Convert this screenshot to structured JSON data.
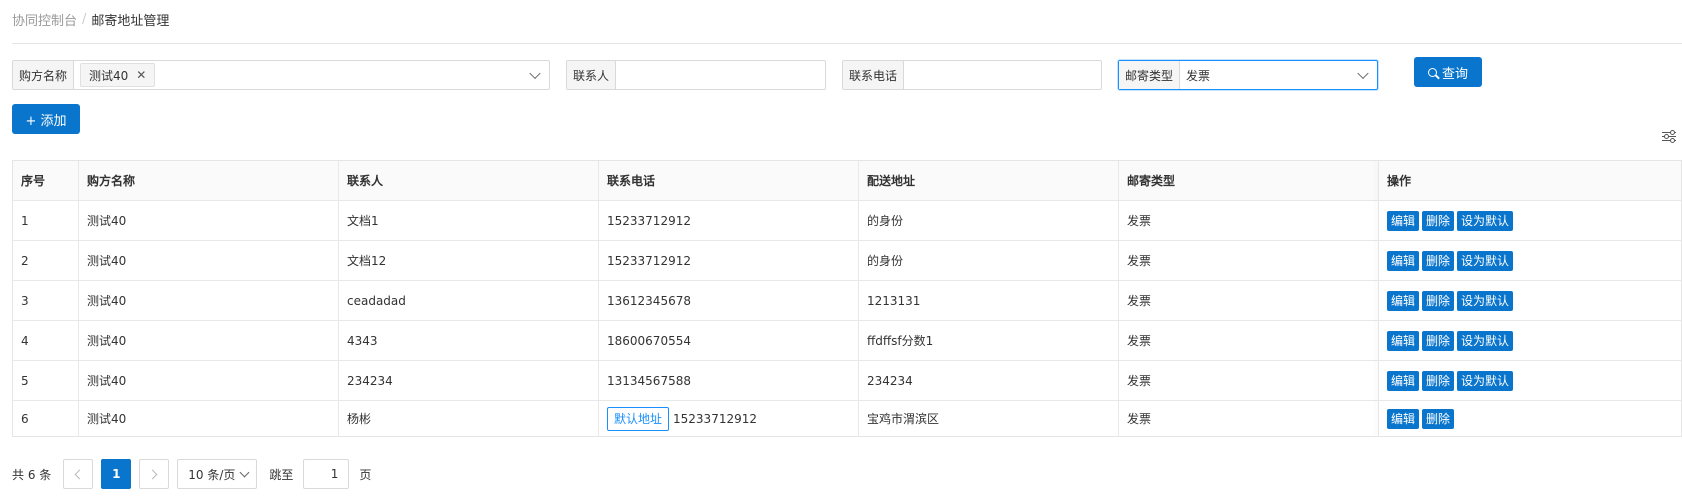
{
  "breadcrumb": {
    "root": "协同控制台",
    "separator": "/",
    "current": "邮寄地址管理"
  },
  "filters": {
    "buyer": {
      "label": "购方名称",
      "tag": "测试40",
      "remove": "✕"
    },
    "contact": {
      "label": "联系人",
      "value": ""
    },
    "phone": {
      "label": "联系电话",
      "value": ""
    },
    "mail_type": {
      "label": "邮寄类型",
      "value": "发票"
    }
  },
  "actions": {
    "query": "查询",
    "add": "+ 添加"
  },
  "icons": {
    "search": "search-icon",
    "settings": "column-settings-icon",
    "chevron": "chevron-down-icon"
  },
  "colors": {
    "primary": "#0a75cc",
    "accent": "#1890ff"
  },
  "table": {
    "headers": [
      "序号",
      "购方名称",
      "联系人",
      "联系电话",
      "配送地址",
      "邮寄类型",
      "操作"
    ],
    "rows": [
      {
        "no": "1",
        "buyer": "测试40",
        "contact": "文档1",
        "phone": "15233712912",
        "address": "的身份",
        "type": "发票",
        "default_tag": "",
        "ops": [
          "编辑",
          "删除",
          "设为默认"
        ]
      },
      {
        "no": "2",
        "buyer": "测试40",
        "contact": "文档12",
        "phone": "15233712912",
        "address": "的身份",
        "type": "发票",
        "default_tag": "",
        "ops": [
          "编辑",
          "删除",
          "设为默认"
        ]
      },
      {
        "no": "3",
        "buyer": "测试40",
        "contact": "ceadadad",
        "phone": "13612345678",
        "address": "1213131",
        "type": "发票",
        "default_tag": "",
        "ops": [
          "编辑",
          "删除",
          "设为默认"
        ]
      },
      {
        "no": "4",
        "buyer": "测试40",
        "contact": "4343",
        "phone": "18600670554",
        "address": "ffdffsf分数1",
        "type": "发票",
        "default_tag": "",
        "ops": [
          "编辑",
          "删除",
          "设为默认"
        ]
      },
      {
        "no": "5",
        "buyer": "测试40",
        "contact": "234234",
        "phone": "13134567588",
        "address": "234234",
        "type": "发票",
        "default_tag": "",
        "ops": [
          "编辑",
          "删除",
          "设为默认"
        ]
      },
      {
        "no": "6",
        "buyer": "测试40",
        "contact": "杨彬",
        "phone": "15233712912",
        "address": "宝鸡市渭滨区",
        "type": "发票",
        "default_tag": "默认地址",
        "ops": [
          "编辑",
          "删除"
        ]
      }
    ]
  },
  "pagination": {
    "total": "共 6 条",
    "current": "1",
    "page_size": "10 条/页",
    "jump_label": "跳至",
    "jump_value": "1",
    "page_unit": "页"
  }
}
